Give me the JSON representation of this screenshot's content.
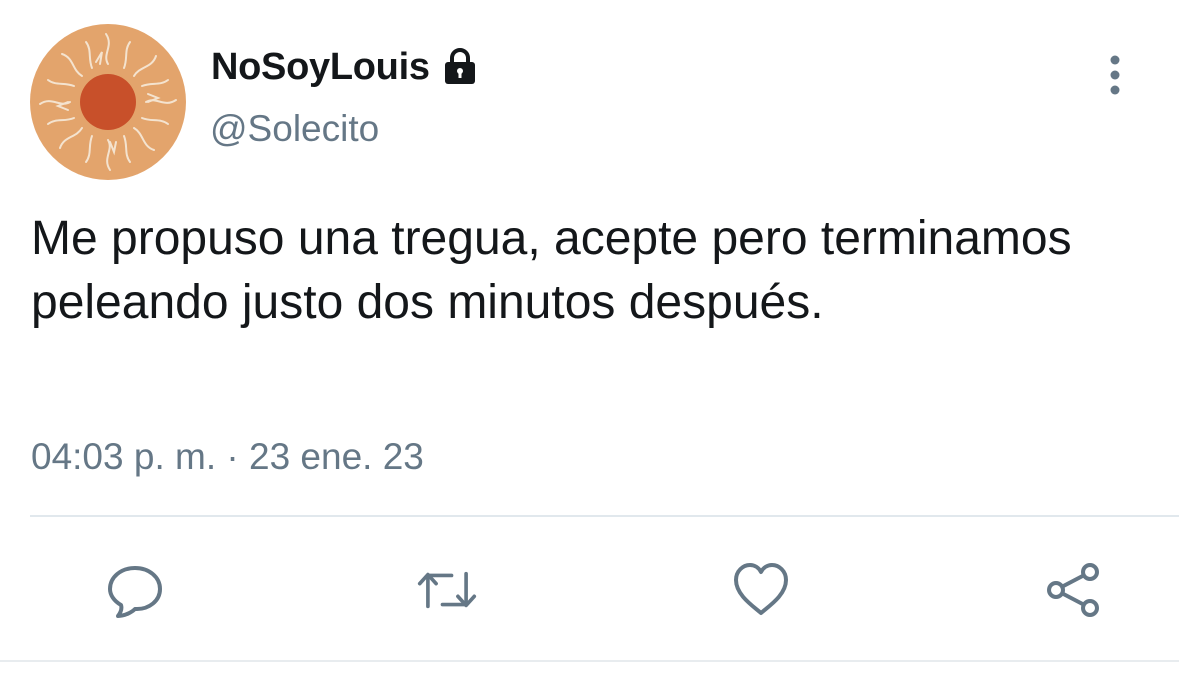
{
  "user": {
    "display_name": "NoSoyLouis",
    "handle": "@Solecito",
    "avatar_icon": "sun-illustration",
    "protected_icon": "lock-icon"
  },
  "tweet": {
    "text": "Me propuso una tregua, acepte pero terminamos peleando justo dos minutos después.",
    "timestamp": "04:03 p. m. · 23 ene. 23"
  },
  "actions": {
    "reply_icon": "comment-icon",
    "retweet_icon": "retweet-icon",
    "like_icon": "heart-icon",
    "share_icon": "share-icon"
  },
  "menu": {
    "more_icon": "more-vertical-icon"
  },
  "colors": {
    "text_primary": "#14171a",
    "text_secondary": "#657786",
    "icon": "#657786",
    "avatar_bg": "#e3a46c",
    "avatar_sun": "#c8502a",
    "divider": "#e1e8ed"
  }
}
